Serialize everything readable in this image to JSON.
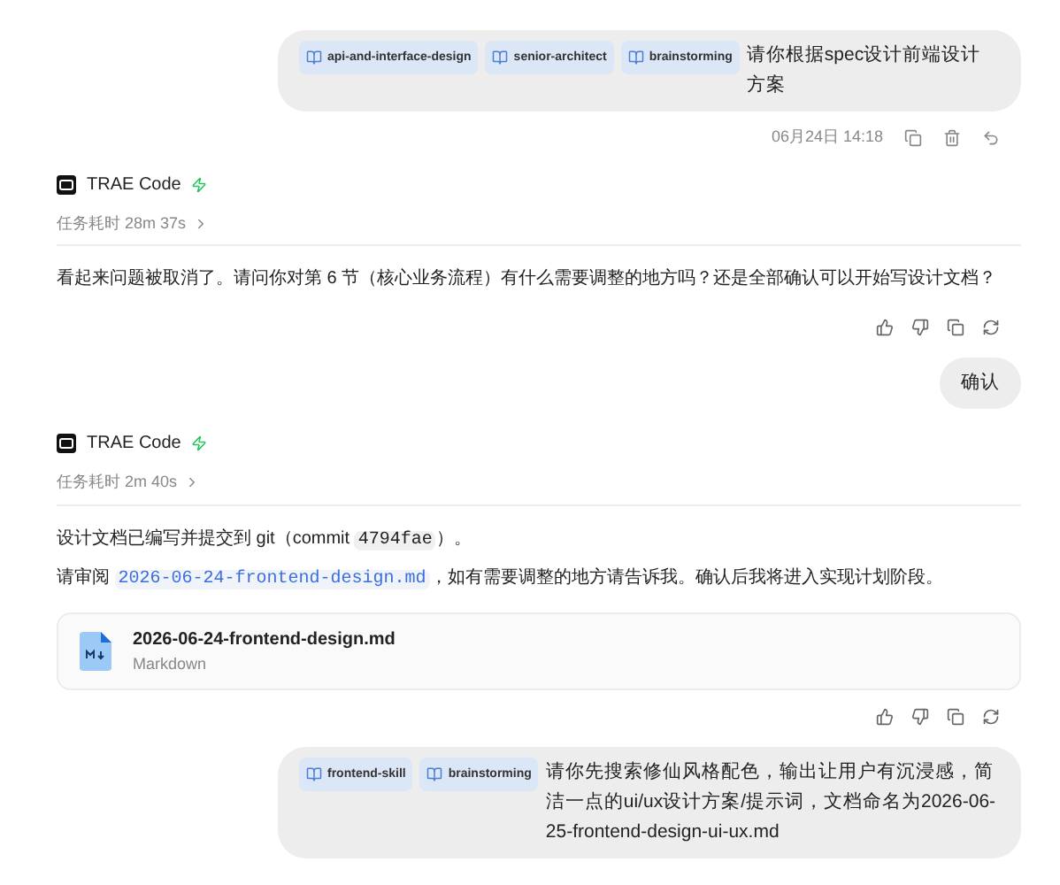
{
  "messages": [
    {
      "kind": "user",
      "tags": [
        "api-and-interface-design",
        "senior-architect",
        "brainstorming"
      ],
      "text": "请你根据spec设计前端设计方案",
      "time": "06月24日 14:18"
    },
    {
      "kind": "assistant",
      "name": "TRAE Code",
      "duration": "任务耗时 28m 37s",
      "paragraphs": [
        [
          {
            "kind": "text",
            "text": "看起来问题被取消了。请问你对第 6 节（核心业务流程）有什么需要调整的地方吗？还是全部确认可以开始写设计文档？"
          }
        ]
      ]
    },
    {
      "kind": "user",
      "text": "确认"
    },
    {
      "kind": "assistant",
      "name": "TRAE Code",
      "duration": "任务耗时 2m 40s",
      "paragraphs": [
        [
          {
            "kind": "text",
            "text": "设计文档已编写并提交到 git（commit "
          },
          {
            "kind": "code",
            "text": "4794fae"
          },
          {
            "kind": "text",
            "text": "）。"
          }
        ],
        [
          {
            "kind": "text",
            "text": "请审阅 "
          },
          {
            "kind": "link",
            "text": "2026-06-24-frontend-design.md"
          },
          {
            "kind": "text",
            "text": "，如有需要调整的地方请告诉我。确认后我将进入实现计划阶段。"
          }
        ]
      ],
      "file": {
        "name": "2026-06-24-frontend-design.md",
        "type": "Markdown"
      }
    },
    {
      "kind": "user",
      "tags": [
        "frontend-skill",
        "brainstorming"
      ],
      "text": "请你先搜索修仙风格配色，输出让用户有沉浸感，简洁一点的ui/ux设计方案/提示词，文档命名为2026-06-25-frontend-design-ui-ux.md"
    }
  ]
}
